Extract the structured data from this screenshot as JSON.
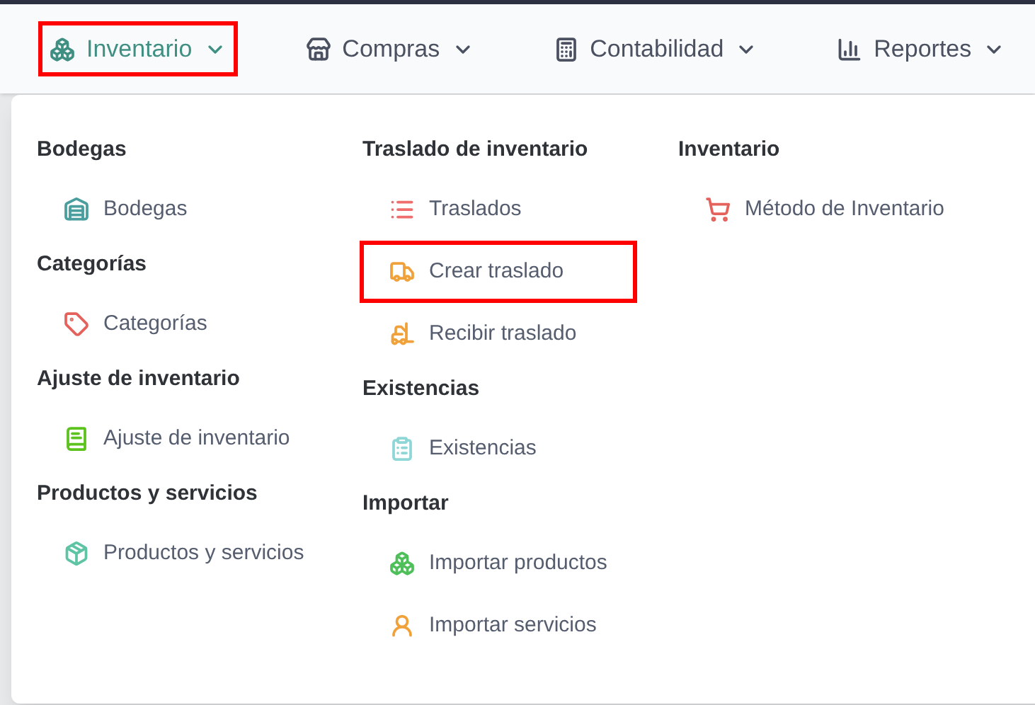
{
  "nav": [
    {
      "label": "Inventario",
      "selected": true,
      "highlighted": true
    },
    {
      "label": "Compras",
      "selected": false,
      "highlighted": false
    },
    {
      "label": "Contabilidad",
      "selected": false,
      "highlighted": false
    },
    {
      "label": "Reportes",
      "selected": false,
      "highlighted": false
    }
  ],
  "menu": {
    "columns": [
      {
        "sections": [
          {
            "heading": "Bodegas",
            "items": [
              {
                "label": "Bodegas",
                "color": "#4a9e9e",
                "highlighted": false
              }
            ]
          },
          {
            "heading": "Categorías",
            "items": [
              {
                "label": "Categorías",
                "color": "#e5625c",
                "highlighted": false
              }
            ]
          },
          {
            "heading": "Ajuste de inventario",
            "items": [
              {
                "label": "Ajuste de inventario",
                "color": "#5cc21e",
                "highlighted": false
              }
            ]
          },
          {
            "heading": "Productos y servicios",
            "items": [
              {
                "label": "Productos y servicios",
                "color": "#5ec4a4",
                "highlighted": false
              }
            ]
          }
        ]
      },
      {
        "sections": [
          {
            "heading": "Traslado de inventario",
            "items": [
              {
                "label": "Traslados",
                "color": "#ef6d6d",
                "highlighted": false
              },
              {
                "label": "Crear traslado",
                "color": "#f0a13a",
                "highlighted": true
              },
              {
                "label": "Recibir traslado",
                "color": "#f0a13a",
                "highlighted": false
              }
            ]
          },
          {
            "heading": "Existencias",
            "items": [
              {
                "label": "Existencias",
                "color": "#8fd6d6",
                "highlighted": false
              }
            ]
          },
          {
            "heading": "Importar",
            "items": [
              {
                "label": "Importar productos",
                "color": "#4fbf5a",
                "highlighted": false
              },
              {
                "label": "Importar servicios",
                "color": "#f0a13a",
                "highlighted": false
              }
            ]
          }
        ]
      },
      {
        "sections": [
          {
            "heading": "Inventario",
            "items": [
              {
                "label": "Método de Inventario",
                "color": "#e5625c",
                "highlighted": false
              }
            ]
          }
        ]
      }
    ]
  }
}
